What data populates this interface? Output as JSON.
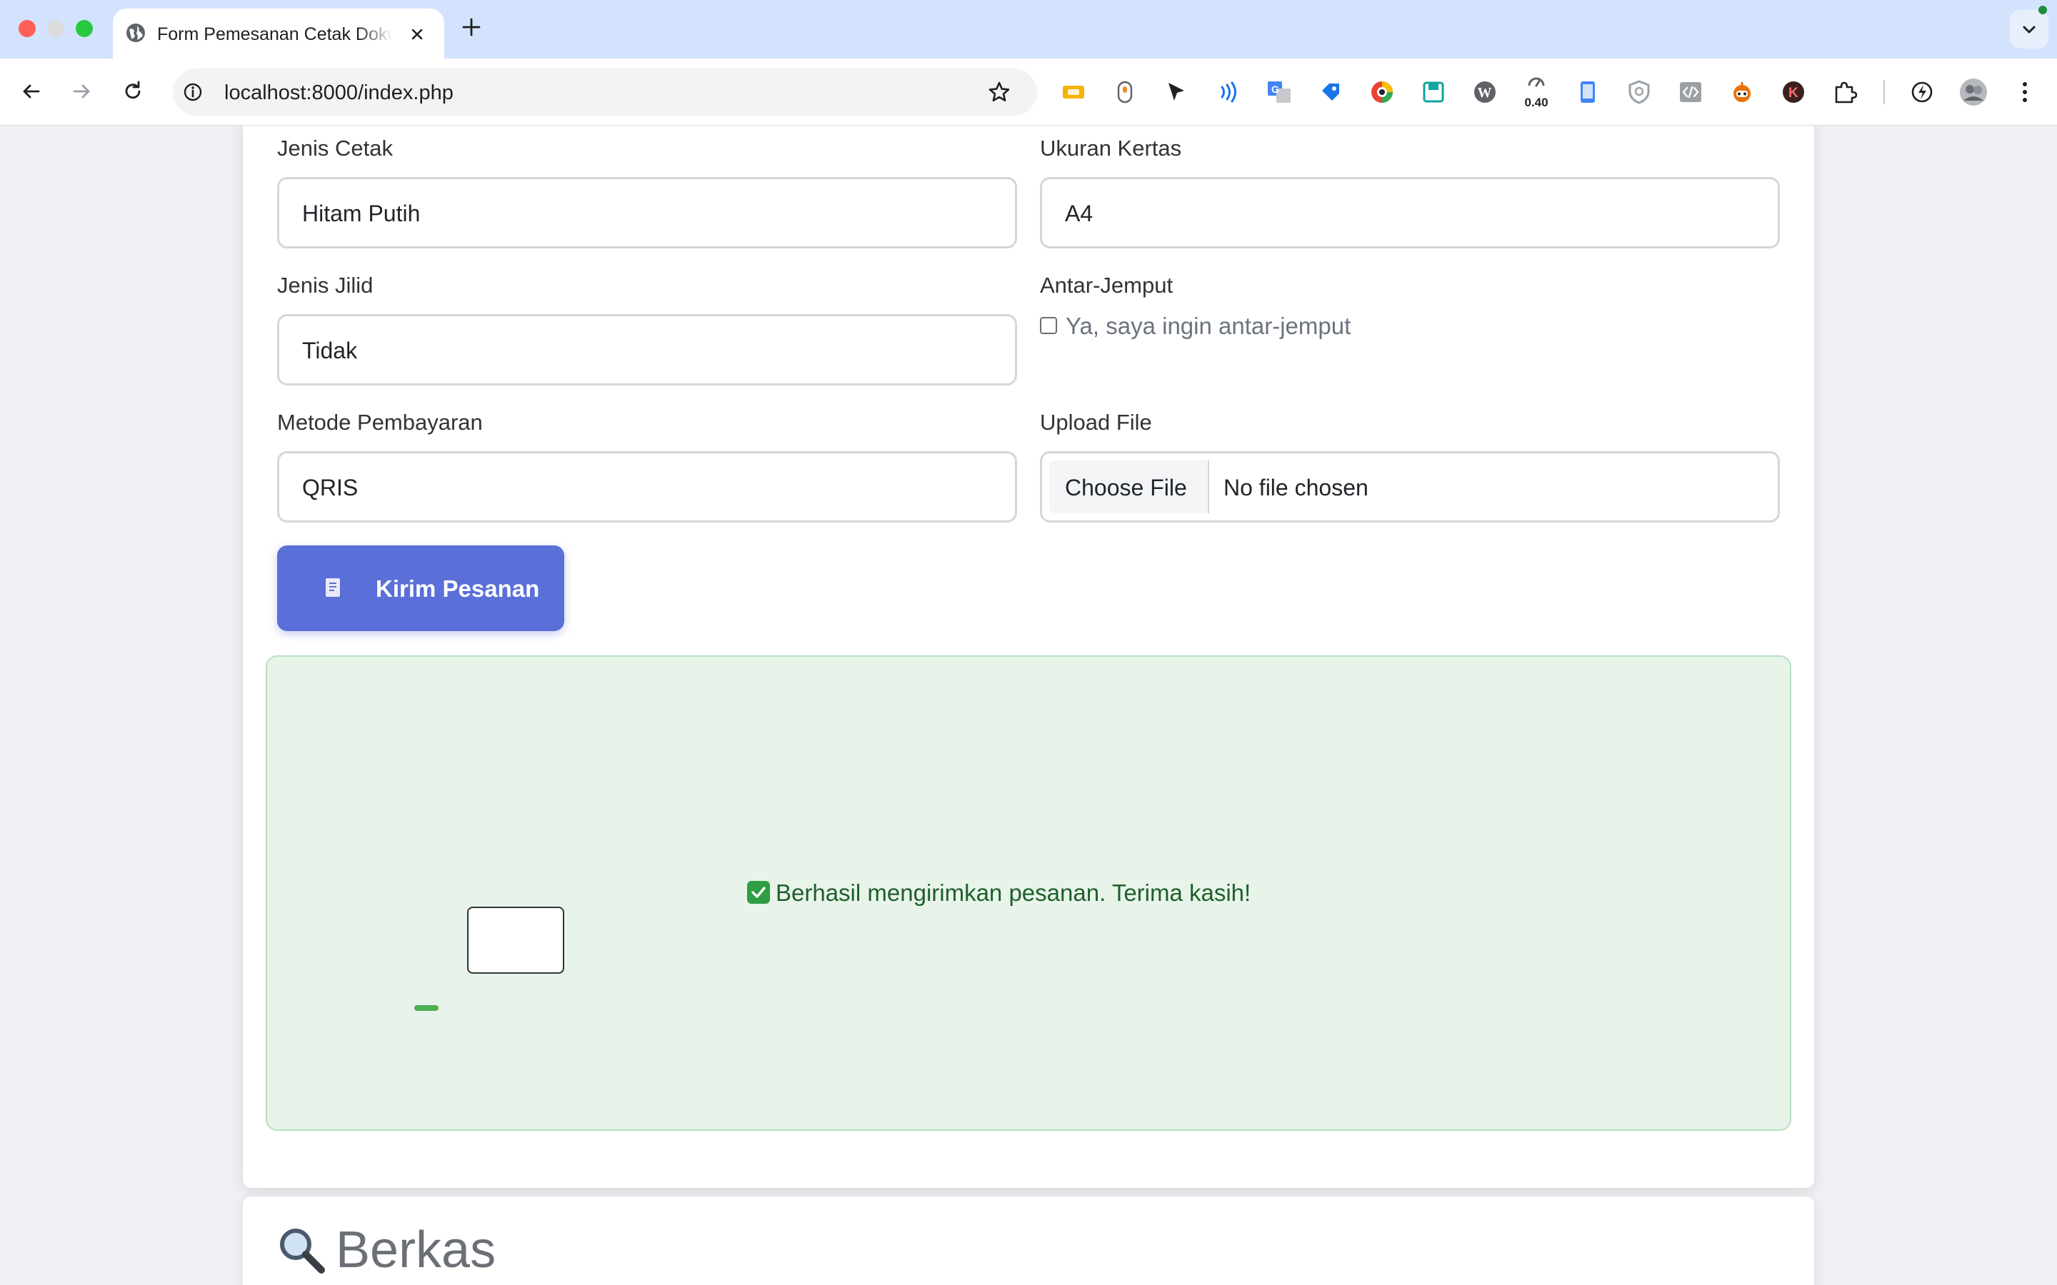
{
  "browser": {
    "tab_title": "Form Pemesanan Cetak Dokumen",
    "url": "localhost:8000/index.php",
    "zoom_badge": "0.40",
    "extensions": [
      "ticket-icon",
      "mouse-icon",
      "cursor-arrow-icon",
      "wave-icon",
      "translate-icon",
      "tag-icon",
      "color-picker-icon",
      "save-icon",
      "wordpress-icon",
      "zoom-icon",
      "phone-icon",
      "shield-icon",
      "code-icon",
      "robot-icon",
      "k-icon",
      "puzzle-icon",
      "performance-icon",
      "profile-avatar"
    ]
  },
  "form": {
    "jenis_cetak": {
      "label": "Jenis Cetak",
      "value": "Hitam Putih"
    },
    "ukuran_kertas": {
      "label": "Ukuran Kertas",
      "value": "A4"
    },
    "jenis_jilid": {
      "label": "Jenis Jilid",
      "value": "Tidak"
    },
    "antar_jemput": {
      "label": "Antar-Jemput",
      "checkbox_label": "Ya, saya ingin antar-jemput",
      "checked": false
    },
    "metode_pembayaran": {
      "label": "Metode Pembayaran",
      "value": "QRIS"
    },
    "upload_file": {
      "label": "Upload File",
      "button": "Choose File",
      "status": "No file chosen"
    },
    "submit": {
      "label": "Kirim Pesanan",
      "icon": "document-icon"
    }
  },
  "alert": {
    "message": "Berhasil mengirimkan pesanan. Terima kasih!",
    "icon": "check-mark-icon",
    "color": "#e8f4ea"
  },
  "section": {
    "title": "Berkas",
    "icon": "magnifier-icon"
  },
  "colors": {
    "accent": "#5a6fd8",
    "success_text": "#1f5f2b",
    "tabstrip": "#d3e3fd"
  }
}
